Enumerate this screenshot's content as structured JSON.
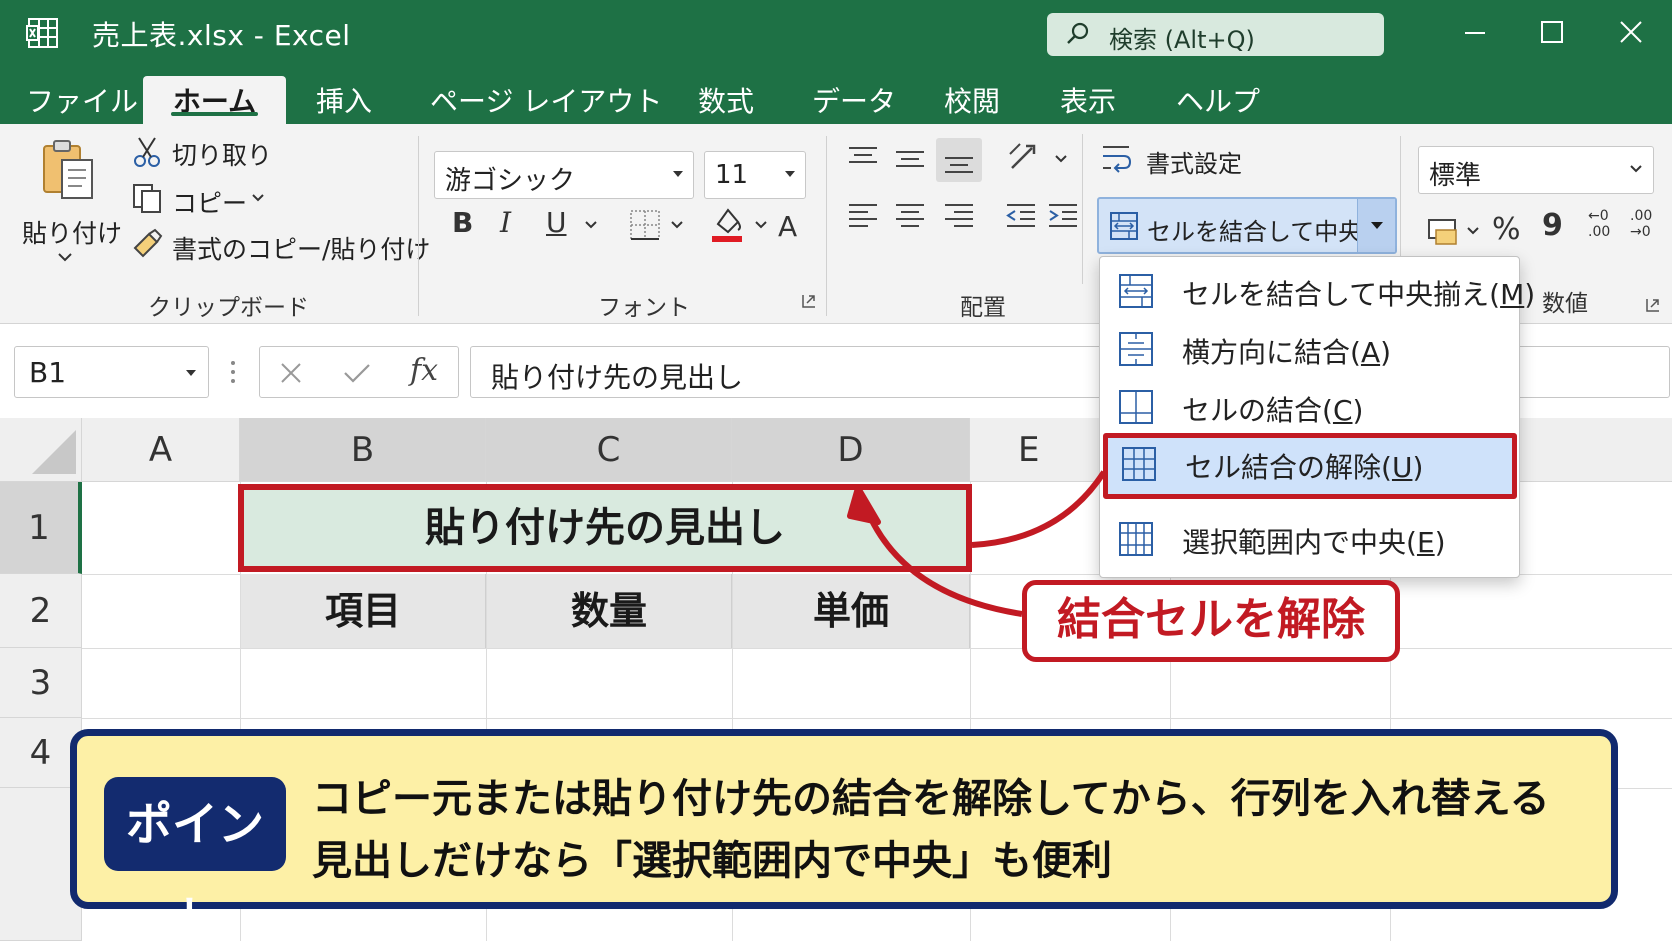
{
  "window": {
    "title": "売上表.xlsx  -  Excel",
    "search_placeholder": "検索 (Alt+Q)"
  },
  "tabs": [
    {
      "label": "ファイル"
    },
    {
      "label": "ホーム",
      "active": true
    },
    {
      "label": "挿入"
    },
    {
      "label": "ページ レイアウト"
    },
    {
      "label": "数式"
    },
    {
      "label": "データ"
    },
    {
      "label": "校閲"
    },
    {
      "label": "表示"
    },
    {
      "label": "ヘルプ"
    }
  ],
  "ribbon": {
    "clipboard": {
      "paste": "貼り付け",
      "cut": "切り取り",
      "copy": "コピー",
      "format_painter": "書式のコピー/貼り付け",
      "group_label": "クリップボード"
    },
    "font": {
      "name": "游ゴシック",
      "size": "11",
      "bold": "B",
      "italic": "I",
      "underline": "U",
      "grow": "A",
      "group_label": "フォント"
    },
    "alignment": {
      "wrap_text": "書式設定",
      "merge_center": "セルを結合して中央揃え",
      "group_label": "配置"
    },
    "number": {
      "format": "標準",
      "percent": "%",
      "comma": "9",
      "inc_decimal": "←0 .00",
      "dec_decimal": ".00 →0",
      "group_label": "数値"
    }
  },
  "formula_bar": {
    "name_box": "B1",
    "fx": "fx",
    "formula": "貼り付け先の見出し"
  },
  "sheet": {
    "columns": [
      "A",
      "B",
      "C",
      "D",
      "E"
    ],
    "rows": [
      "1",
      "2",
      "3",
      "4"
    ],
    "merged_title": "貼り付け先の見出し",
    "headers": [
      "項目",
      "数量",
      "単価"
    ]
  },
  "merge_menu": {
    "items": [
      {
        "label": "セルを結合して中央揃え(",
        "key": "M",
        "close": ")",
        "highlighted": false
      },
      {
        "label": "横方向に結合(",
        "key": "A",
        "close": ")",
        "highlighted": false
      },
      {
        "label": "セルの結合(",
        "key": "C",
        "close": ")",
        "highlighted": false
      },
      {
        "label": "セル結合の解除(",
        "key": "U",
        "close": ")",
        "highlighted": true
      },
      {
        "label": "選択範囲内で中央(",
        "key": "E",
        "close": ")",
        "highlighted": false
      }
    ]
  },
  "callout": "結合セルを解除",
  "point": {
    "badge": "ポイント",
    "line1": "コピー元または貼り付け先の結合を解除してから、行列を入れ替える",
    "line2": "見出しだけなら「選択範囲内で中央」も便利"
  },
  "colors": {
    "excel_green": "#1e7145",
    "highlight_red": "#c21a23",
    "navy": "#132b6f",
    "point_yellow": "#fdf0a6",
    "menu_highlight": "#cfe2fa"
  }
}
